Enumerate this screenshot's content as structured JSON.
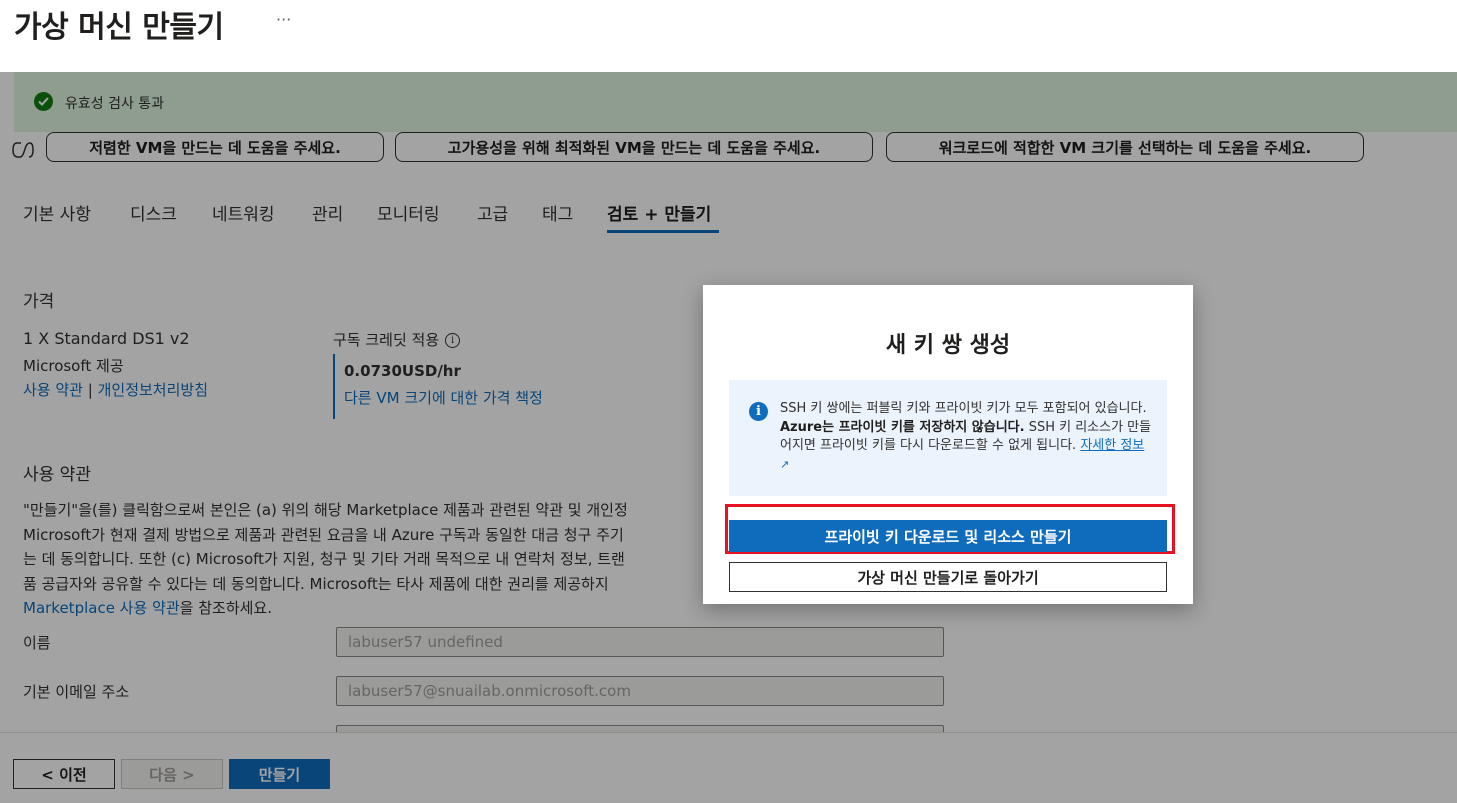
{
  "header": {
    "title": "가상 머신 만들기",
    "more": "···"
  },
  "validation": {
    "message": "유효성 검사 통과",
    "color": "#107c10"
  },
  "copilot_prompts": [
    "저렴한 VM을 만드는 데 도움을 주세요.",
    "고가용성을 위해 최적화된 VM을 만드는 데 도움을 주세요.",
    "워크로드에 적합한 VM 크기를 선택하는 데 도움을 주세요."
  ],
  "tabs": [
    "기본 사항",
    "디스크",
    "네트워킹",
    "관리",
    "모니터링",
    "고급",
    "태그",
    "검토 + 만들기"
  ],
  "active_tab": "검토 + 만들기",
  "pricing": {
    "heading": "가격",
    "size": "1 X Standard DS1 v2",
    "provider": "Microsoft 제공",
    "terms_link": "사용 약관",
    "separator": "|",
    "privacy_link": "개인정보처리방침",
    "credit_label": "구독 크레딧 적용",
    "price": "0.0730USD/hr",
    "other_sizes_link": "다른 VM 크기에 대한 가격 책정"
  },
  "terms": {
    "heading": "사용 약관",
    "lines": [
      "\"만들기\"을(를) 클릭함으로써 본인은 (a) 위의 해당 Marketplace 제품과 관련된 약관 및 개인정",
      "Microsoft가 현재 결제 방법으로 제품과 관련된 요금을 내 Azure 구독과 동일한 대금 청구 주기",
      "는 데 동의합니다. 또한 (c) Microsoft가 지원, 청구 및 기타 거래 목적으로 내 연락처 정보, 트랜",
      "품 공급자와 공유할 수 있다는 데 동의합니다. Microsoft는 타사 제품에 대한 권리를 제공하지"
    ],
    "link": "Marketplace 사용 약관",
    "link_suffix": "을 참조하세요."
  },
  "fields": [
    {
      "label": "이름",
      "value": "labuser57 undefined"
    },
    {
      "label": "기본 이메일 주소",
      "value": "labuser57@snuailab.onmicrosoft.com"
    }
  ],
  "footer": {
    "prev": "< 이전",
    "next": "다음 >",
    "create": "만들기"
  },
  "dialog": {
    "title": "새 키 쌍 생성",
    "info_part1": "SSH 키 쌍에는 퍼블릭 키와 프라이빗 키가 모두 포함되어 있습니다. ",
    "info_bold": "Azure는 프라이빗 키를 저장하지 않습니다.",
    "info_part2": " SSH 키 리소스가 만들어지면 프라이빗 키를 다시 다운로드할 수 없게 됩니다. ",
    "info_link": "자세한 정보",
    "download_button": "프라이빗 키 다운로드 및 리소스 만들기",
    "back_button": "가상 머신 만들기로 돌아가기",
    "highlight_color": "#e81123",
    "accent": "#0f6cbd"
  }
}
